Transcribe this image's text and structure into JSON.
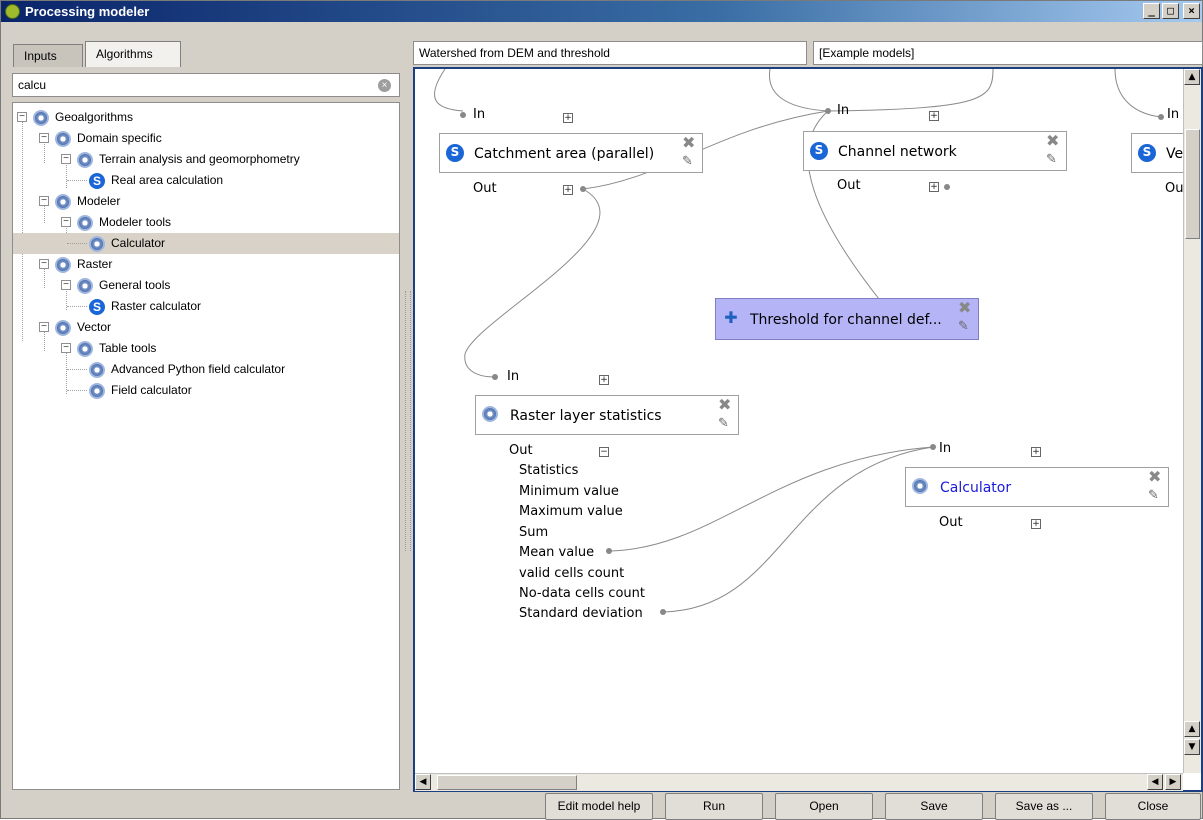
{
  "window": {
    "title": "Processing modeler"
  },
  "tabs": [
    {
      "label": "Inputs"
    },
    {
      "label": "Algorithms"
    }
  ],
  "search": {
    "value": "calcu"
  },
  "tree": [
    {
      "label": "Geoalgorithms",
      "icon": "gear-icon"
    },
    {
      "label": "Domain specific",
      "icon": "gear-icon"
    },
    {
      "label": "Terrain analysis and geomorphometry",
      "icon": "gear-icon"
    },
    {
      "label": "Real area calculation",
      "icon": "saga-icon"
    },
    {
      "label": "Modeler",
      "icon": "gear-icon"
    },
    {
      "label": "Modeler tools",
      "icon": "gear-icon"
    },
    {
      "label": "Calculator",
      "icon": "gear-icon",
      "selected": true
    },
    {
      "label": "Raster",
      "icon": "gear-icon"
    },
    {
      "label": "General tools",
      "icon": "gear-icon"
    },
    {
      "label": "Raster calculator",
      "icon": "saga-icon"
    },
    {
      "label": "Vector",
      "icon": "gear-icon"
    },
    {
      "label": "Table tools",
      "icon": "gear-icon"
    },
    {
      "label": "Advanced Python field calculator",
      "icon": "gear-icon"
    },
    {
      "label": "Field calculator",
      "icon": "gear-icon"
    }
  ],
  "model": {
    "name": "Watershed from DEM and threshold",
    "group": "[Example models]"
  },
  "canvas": {
    "nodes": [
      {
        "label": "Catchment area (parallel)",
        "icon": "saga-icon",
        "in_label": "In",
        "out_label": "Out"
      },
      {
        "label": "Channel network",
        "icon": "saga-icon",
        "in_label": "In",
        "out_label": "Out"
      },
      {
        "label": "Ve",
        "icon": "saga-icon",
        "in_label": "In",
        "out_label": "Ou"
      },
      {
        "label": "Threshold for channel def...",
        "icon": "plus-icon"
      },
      {
        "label": "Raster layer statistics",
        "icon": "gear-icon",
        "in_label": "In",
        "out_label": "Out",
        "outputs": [
          "Statistics",
          "Minimum value",
          "Maximum value",
          "Sum",
          "Mean value",
          "valid cells count",
          "No-data cells count",
          "Standard deviation"
        ]
      },
      {
        "label": "Calculator",
        "icon": "gear-icon",
        "in_label": "In",
        "out_label": "Out"
      }
    ]
  },
  "buttons": {
    "edit_help": "Edit model help",
    "run": "Run",
    "open": "Open",
    "save": "Save",
    "save_as": "Save as ...",
    "close": "Close"
  },
  "colors": {
    "title_bar": "#0a246a",
    "param_node": "#b4b4f7",
    "calculator_label": "#1a1adc"
  }
}
